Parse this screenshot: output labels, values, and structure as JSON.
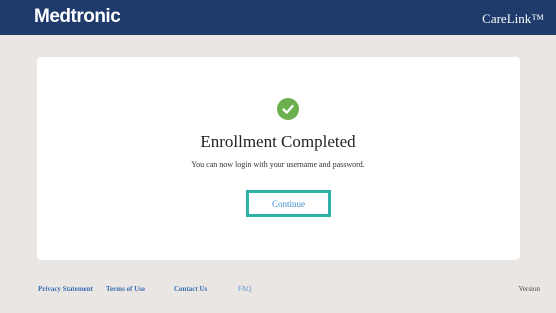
{
  "header": {
    "brand": "Medtronic",
    "product": "CareLink™"
  },
  "main": {
    "title": "Enrollment Completed",
    "message": "You can now login with your username and password.",
    "continue_label": "Continue",
    "status_icon": "check-icon"
  },
  "footer": {
    "links": [
      "Privacy Statement",
      "Terms of Use",
      "Contact Us",
      "FAQ"
    ],
    "version_label": "Version"
  },
  "colors": {
    "header_bg": "#1e3b6b",
    "success": "#6ab04c",
    "highlight": "#2fb0a6",
    "link": "#3a6fb5"
  }
}
